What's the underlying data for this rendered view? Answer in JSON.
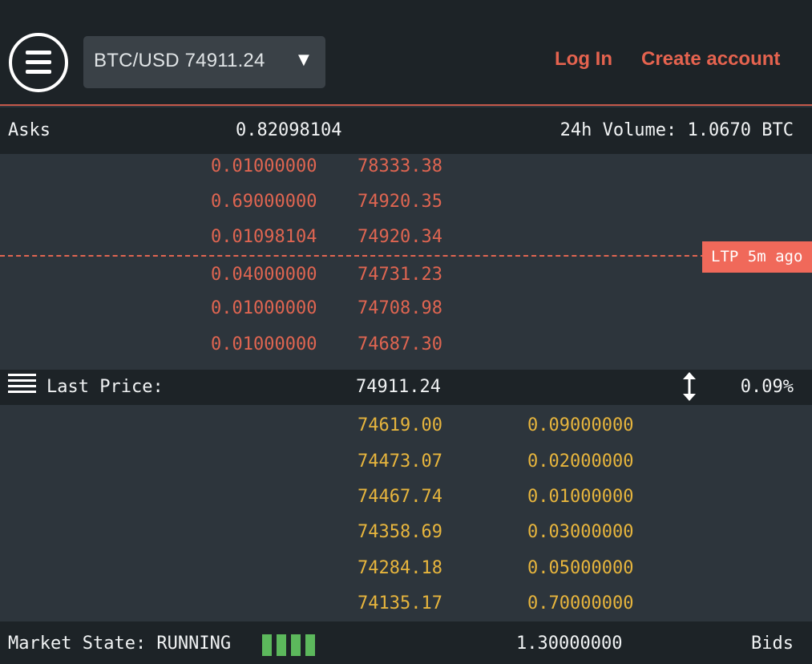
{
  "header": {
    "pair_selector": "BTC/USD 74911.24",
    "caret": "▼",
    "login": "Log In",
    "create_account": "Create account"
  },
  "asks_header": {
    "title": "Asks",
    "total": "0.82098104",
    "volume": "24h Volume: 1.0670 BTC"
  },
  "asks": [
    {
      "amount": "0.01000000",
      "price": "78333.38"
    },
    {
      "amount": "0.69000000",
      "price": "74920.35"
    },
    {
      "amount": "0.01098104",
      "price": "74920.34"
    },
    {
      "amount": "0.04000000",
      "price": "74731.23"
    },
    {
      "amount": "0.01000000",
      "price": "74708.98"
    },
    {
      "amount": "0.01000000",
      "price": "74687.30"
    }
  ],
  "ltp_tag": "LTP 5m ago",
  "last_price": {
    "label": "Last Price:",
    "value": "74911.24",
    "change": "0.09%"
  },
  "bids": [
    {
      "price": "74619.00",
      "amount": "0.09000000"
    },
    {
      "price": "74473.07",
      "amount": "0.02000000"
    },
    {
      "price": "74467.74",
      "amount": "0.01000000"
    },
    {
      "price": "74358.69",
      "amount": "0.03000000"
    },
    {
      "price": "74284.18",
      "amount": "0.05000000"
    },
    {
      "price": "74135.17",
      "amount": "0.70000000"
    }
  ],
  "footer": {
    "market_state": "Market State: RUNNING",
    "bids_total": "1.30000000",
    "bids_title": "Bids"
  },
  "colors": {
    "ask": "#df6551",
    "bid": "#e7b53d",
    "link": "#e5634f",
    "status_bar": "#5cb85c"
  },
  "icons": {
    "menu": "hamburger-menu-icon",
    "order_book_toggle": "list-icon",
    "swap": "vertical-arrows-icon"
  }
}
